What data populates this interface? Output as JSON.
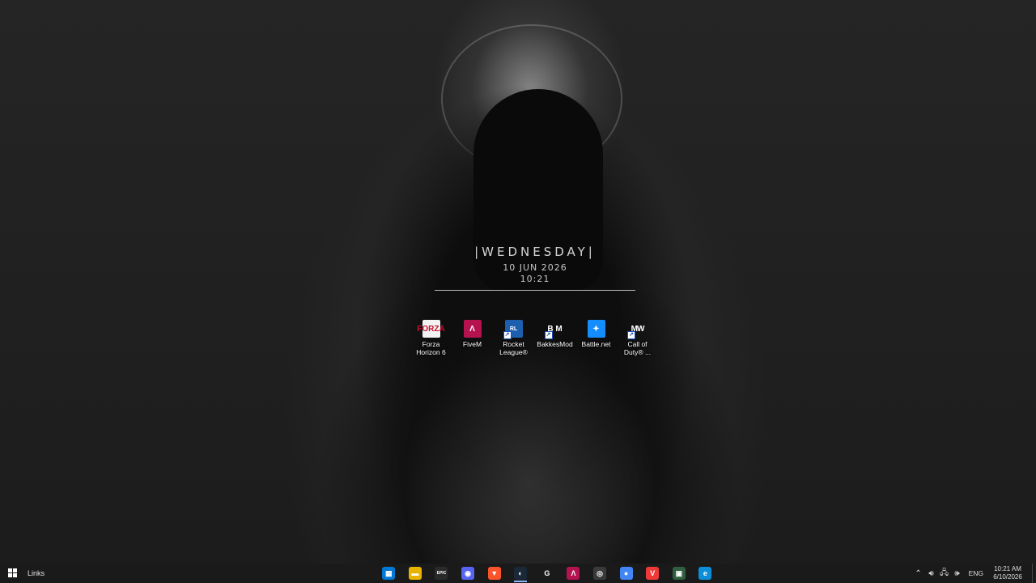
{
  "widget": {
    "weekday": "|WEDNESDAY|",
    "date": "10 JUN 2026",
    "time": "10:21"
  },
  "desktop_icons": [
    {
      "label": "Forza Horizon 6",
      "icon": "forza-icon",
      "glyph": "FORZA"
    },
    {
      "label": "FiveM",
      "icon": "fivem-icon",
      "glyph": "Λ"
    },
    {
      "label": "Rocket League®",
      "icon": "rocket-league-icon",
      "glyph": "RL"
    },
    {
      "label": "BakkesMod",
      "icon": "bakkesmod-icon",
      "glyph": "B M"
    },
    {
      "label": "Battle.net",
      "icon": "battlenet-icon",
      "glyph": "✦"
    },
    {
      "label": "Call of Duty® ...",
      "icon": "mw-icon",
      "glyph": "MW"
    }
  ],
  "taskbar": {
    "toolbar_label": "Links",
    "apps": [
      {
        "name": "microsoft-store-icon",
        "glyph": "▦",
        "color": "#0078d4",
        "active": false
      },
      {
        "name": "file-explorer-icon",
        "glyph": "▬",
        "color": "#e8b400",
        "active": false
      },
      {
        "name": "epic-games-icon",
        "glyph": "EPIC",
        "color": "#2a2a2a",
        "active": false
      },
      {
        "name": "discord-icon",
        "glyph": "◉",
        "color": "#5865f2",
        "active": false
      },
      {
        "name": "brave-icon",
        "glyph": "▼",
        "color": "#fb542b",
        "active": false
      },
      {
        "name": "steam-icon",
        "glyph": "◐",
        "color": "#1b2838",
        "active": true
      },
      {
        "name": "g-hub-icon",
        "glyph": "G",
        "color": "#1a1a1a",
        "active": false
      },
      {
        "name": "fivem-taskbar-icon",
        "glyph": "Λ",
        "color": "#b4134f",
        "active": false
      },
      {
        "name": "obs-icon",
        "glyph": "◎",
        "color": "#3a3a3a",
        "active": false
      },
      {
        "name": "chrome-icon",
        "glyph": "●",
        "color": "#4285f4",
        "active": false
      },
      {
        "name": "vivaldi-icon",
        "glyph": "V",
        "color": "#ef3939",
        "active": false
      },
      {
        "name": "xbox-icon",
        "glyph": "▣",
        "color": "#2f5f3f",
        "active": false
      },
      {
        "name": "edge-icon",
        "glyph": "e",
        "color": "#0c8fd8",
        "active": false
      }
    ],
    "tray": {
      "language": "ENG",
      "clock_time": "10:21 AM",
      "clock_date": "6/10/2026"
    }
  }
}
